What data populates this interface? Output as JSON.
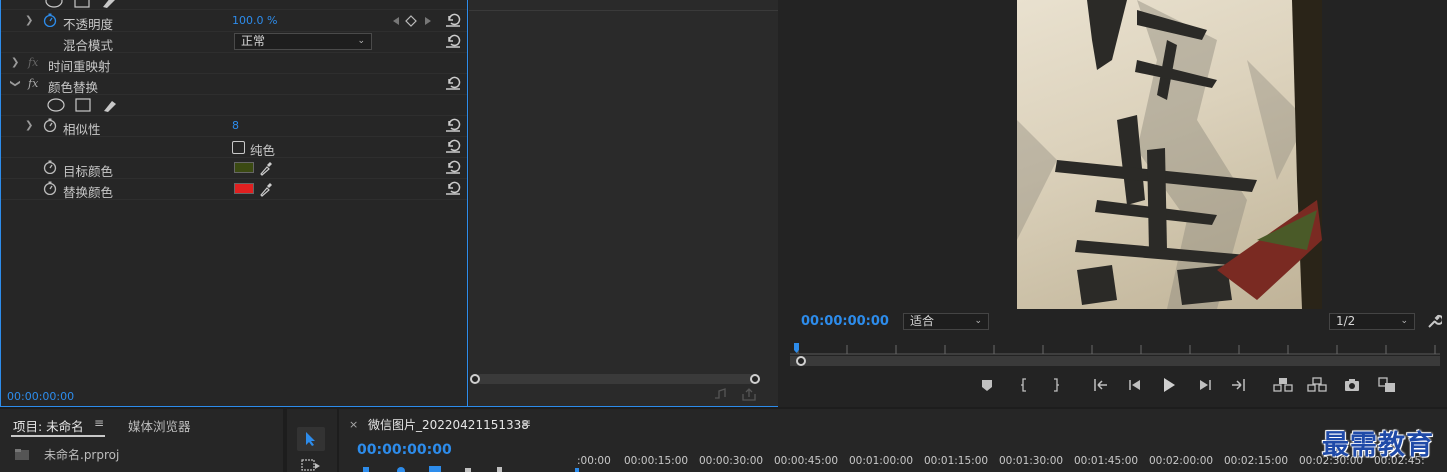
{
  "effect_controls": {
    "opacity": {
      "label": "不透明度",
      "value": "100.0 %"
    },
    "blend_mode": {
      "label": "混合模式",
      "value": "正常"
    },
    "time_remap": {
      "label": "时间重映射",
      "fx": "fx"
    },
    "color_replace": {
      "label": "颜色替换",
      "fx": "fx"
    },
    "similarity": {
      "label": "相似性",
      "value": "8"
    },
    "solid_colors": {
      "label": "纯色"
    },
    "target_color": {
      "label": "目标颜色",
      "swatch": "#3b4a12"
    },
    "replace_color": {
      "label": "替换颜色",
      "swatch": "#e02020"
    },
    "timecode": "00:00:00:00"
  },
  "program_monitor": {
    "timecode": "00:00:00:00",
    "fit": "适合",
    "resolution": "1/2",
    "accent": "#2d8ceb"
  },
  "project_panel": {
    "tab_project": "项目: 未命名",
    "tab_media_browser": "媒体浏览器",
    "file": "未命名.prproj"
  },
  "timeline": {
    "sequence_name": "微信图片_20220421151338",
    "timecode": "00:00:00:00",
    "ticks": [
      ":00:00",
      "00:00:15:00",
      "00:00:30:00",
      "00:00:45:00",
      "00:01:00:00",
      "00:01:15:00",
      "00:01:30:00",
      "00:01:45:00",
      "00:02:00:00",
      "00:02:15:00",
      "00:02:30:00",
      "00:02:45:"
    ]
  },
  "watermark": "最需教育"
}
